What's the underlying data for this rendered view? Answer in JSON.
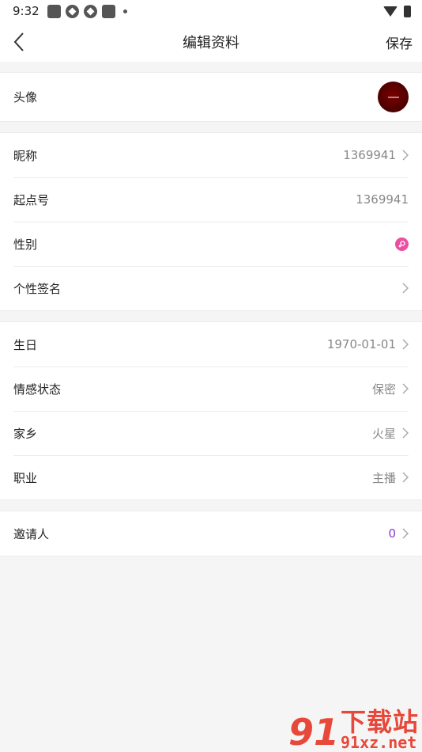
{
  "status_bar": {
    "time": "9:32"
  },
  "nav": {
    "title": "编辑资料",
    "save_label": "保存"
  },
  "groups": [
    {
      "rows": [
        {
          "label": "头像",
          "type": "avatar"
        }
      ]
    },
    {
      "rows": [
        {
          "label": "昵称",
          "value": "1369941",
          "chevron": true
        },
        {
          "label": "起点号",
          "value": "1369941",
          "chevron": false
        },
        {
          "label": "性别",
          "type": "gender",
          "value": "female"
        },
        {
          "label": "个性签名",
          "value": "",
          "chevron": true
        }
      ]
    },
    {
      "rows": [
        {
          "label": "生日",
          "value": "1970-01-01",
          "chevron": true
        },
        {
          "label": "情感状态",
          "value": "保密",
          "chevron": true
        },
        {
          "label": "家乡",
          "value": "火星",
          "chevron": true
        },
        {
          "label": "职业",
          "value": "主播",
          "chevron": true
        }
      ]
    },
    {
      "rows": [
        {
          "label": "邀请人",
          "value": "0",
          "chevron": true,
          "accent": true
        }
      ]
    }
  ],
  "colors": {
    "accent": "#8a3ad6",
    "gender_female": "#ec4fa0",
    "watermark": "#e8483a"
  },
  "watermark": {
    "logo": "91",
    "cn": "下载站",
    "url": "91xz.net"
  }
}
